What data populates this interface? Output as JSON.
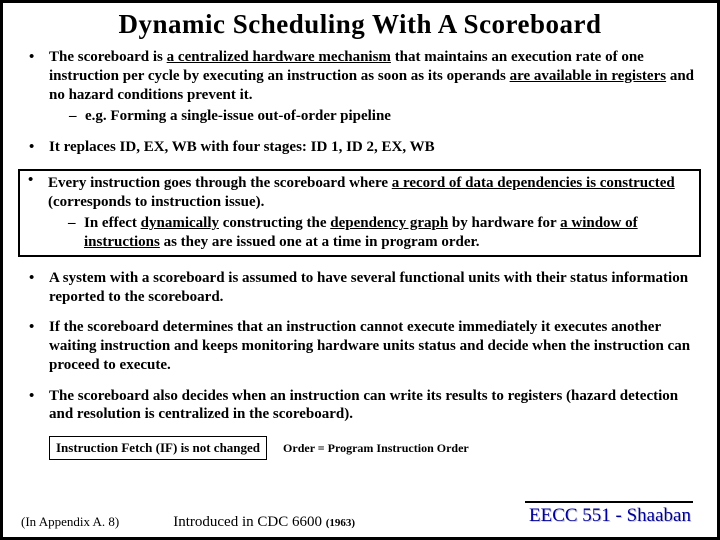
{
  "title": "Dynamic Scheduling With A Scoreboard",
  "bullets": {
    "b1_a": "The scoreboard is ",
    "b1_u1": "a centralized hardware mechanism",
    "b1_b": " that maintains an execution rate of one instruction per cycle by executing an instruction as soon as its operands ",
    "b1_u2": "are available in registers",
    "b1_c": " and no hazard conditions prevent it.",
    "b1_sub": "e.g. Forming a single-issue out-of-order pipeline",
    "b2": "It replaces ID, EX, WB with four stages:  ID 1, ID 2, EX, WB",
    "b3_a": "Every instruction goes through the scoreboard where ",
    "b3_u1": "a record of data dependencies is constructed",
    "b3_b": " (corresponds to instruction issue).",
    "b3_sub_a": "In effect ",
    "b3_sub_u1": "dynamically",
    "b3_sub_b": " constructing the ",
    "b3_sub_u2": "dependency graph",
    "b3_sub_c": "  by hardware for ",
    "b3_sub_u3": "a window of instructions",
    "b3_sub_d": " as they are issued one at a time in program order.",
    "b4": "A system with a scoreboard is assumed to have several functional units with their status information reported to the scoreboard.",
    "b5": "If the scoreboard determines that an instruction cannot execute immediately it executes another waiting instruction and keeps monitoring hardware units status and decide when the instruction can  proceed to execute.",
    "b6": "The scoreboard also decides when an instruction can write its results to registers (hazard detection and resolution is centralized in the scoreboard)."
  },
  "footer": {
    "ifbox": "Instruction Fetch (IF) is not changed",
    "order": "Order = Program Instruction Order",
    "appendix": "(In  Appendix A. 8)",
    "cdc": "Introduced in CDC 6600 ",
    "year": "(1963)",
    "eecc": "EECC 551 - Shaaban"
  }
}
